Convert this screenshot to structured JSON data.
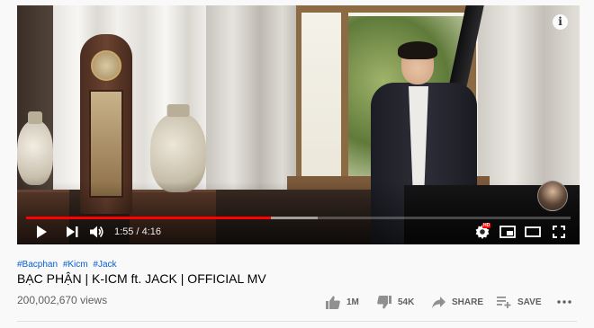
{
  "player": {
    "time_current": "1:55",
    "time_total": "4:16",
    "time_separator": " / ",
    "progress_played_fraction": 0.45,
    "progress_buffered_fraction": 0.535,
    "hd_badge": "HD",
    "info_icon": "info-icon",
    "accent_color": "#ff0000"
  },
  "video": {
    "hashtags": [
      "#Bacphan",
      "#Kicm",
      "#Jack"
    ],
    "title": "BẠC PHẬN | K-ICM ft. JACK | OFFICIAL MV",
    "views": "200,002,670 views",
    "likes": "1M",
    "dislikes": "54K",
    "share_label": "SHARE",
    "save_label": "SAVE"
  },
  "colors": {
    "hashtag": "#065fd4",
    "title": "#030303",
    "secondary_text": "#606060",
    "background": "#f9f9f9"
  }
}
